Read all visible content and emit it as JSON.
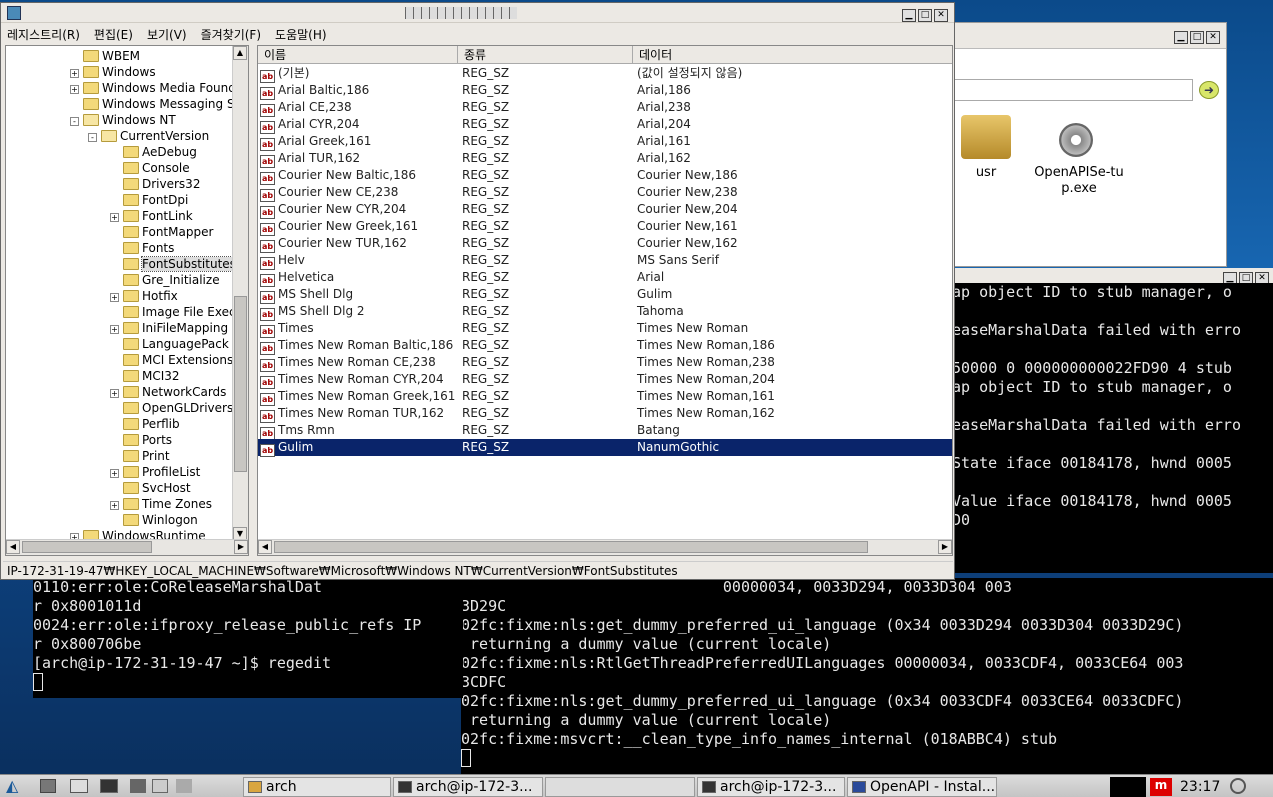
{
  "regedit": {
    "menu": [
      "레지스트리(R)",
      "편집(E)",
      "보기(V)",
      "즐겨찾기(F)",
      "도움말(H)"
    ],
    "tree": [
      {
        "label": "WBEM",
        "indent": 0,
        "exp": ""
      },
      {
        "label": "Windows",
        "indent": 0,
        "exp": "+"
      },
      {
        "label": "Windows Media Founda",
        "indent": 0,
        "exp": "+"
      },
      {
        "label": "Windows Messaging Su",
        "indent": 0,
        "exp": ""
      },
      {
        "label": "Windows NT",
        "indent": 0,
        "exp": "-"
      },
      {
        "label": "CurrentVersion",
        "indent": 1,
        "exp": "-"
      },
      {
        "label": "AeDebug",
        "indent": 2,
        "exp": ""
      },
      {
        "label": "Console",
        "indent": 2,
        "exp": ""
      },
      {
        "label": "Drivers32",
        "indent": 2,
        "exp": ""
      },
      {
        "label": "FontDpi",
        "indent": 2,
        "exp": ""
      },
      {
        "label": "FontLink",
        "indent": 2,
        "exp": "+"
      },
      {
        "label": "FontMapper",
        "indent": 2,
        "exp": ""
      },
      {
        "label": "Fonts",
        "indent": 2,
        "exp": ""
      },
      {
        "label": "FontSubstitutes",
        "indent": 2,
        "exp": "",
        "selected": true
      },
      {
        "label": "Gre_Initialize",
        "indent": 2,
        "exp": ""
      },
      {
        "label": "Hotfix",
        "indent": 2,
        "exp": "+"
      },
      {
        "label": "Image File Execu",
        "indent": 2,
        "exp": ""
      },
      {
        "label": "IniFileMapping",
        "indent": 2,
        "exp": "+"
      },
      {
        "label": "LanguagePack",
        "indent": 2,
        "exp": ""
      },
      {
        "label": "MCI Extensions",
        "indent": 2,
        "exp": ""
      },
      {
        "label": "MCI32",
        "indent": 2,
        "exp": ""
      },
      {
        "label": "NetworkCards",
        "indent": 2,
        "exp": "+"
      },
      {
        "label": "OpenGLDrivers",
        "indent": 2,
        "exp": ""
      },
      {
        "label": "Perflib",
        "indent": 2,
        "exp": ""
      },
      {
        "label": "Ports",
        "indent": 2,
        "exp": ""
      },
      {
        "label": "Print",
        "indent": 2,
        "exp": ""
      },
      {
        "label": "ProfileList",
        "indent": 2,
        "exp": "+"
      },
      {
        "label": "SvcHost",
        "indent": 2,
        "exp": ""
      },
      {
        "label": "Time Zones",
        "indent": 2,
        "exp": "+"
      },
      {
        "label": "Winlogon",
        "indent": 2,
        "exp": ""
      },
      {
        "label": "WindowsRuntime",
        "indent": 0,
        "exp": "+"
      }
    ],
    "columns": [
      "이름",
      "종류",
      "데이터"
    ],
    "rows": [
      [
        "(기본)",
        "REG_SZ",
        "(값이 설정되지 않음)"
      ],
      [
        "Arial Baltic,186",
        "REG_SZ",
        "Arial,186"
      ],
      [
        "Arial CE,238",
        "REG_SZ",
        "Arial,238"
      ],
      [
        "Arial CYR,204",
        "REG_SZ",
        "Arial,204"
      ],
      [
        "Arial Greek,161",
        "REG_SZ",
        "Arial,161"
      ],
      [
        "Arial TUR,162",
        "REG_SZ",
        "Arial,162"
      ],
      [
        "Courier New Baltic,186",
        "REG_SZ",
        "Courier New,186"
      ],
      [
        "Courier New CE,238",
        "REG_SZ",
        "Courier New,238"
      ],
      [
        "Courier New CYR,204",
        "REG_SZ",
        "Courier New,204"
      ],
      [
        "Courier New Greek,161",
        "REG_SZ",
        "Courier New,161"
      ],
      [
        "Courier New TUR,162",
        "REG_SZ",
        "Courier New,162"
      ],
      [
        "Helv",
        "REG_SZ",
        "MS Sans Serif"
      ],
      [
        "Helvetica",
        "REG_SZ",
        "Arial"
      ],
      [
        "MS Shell Dlg",
        "REG_SZ",
        "Gulim"
      ],
      [
        "MS Shell Dlg 2",
        "REG_SZ",
        "Tahoma"
      ],
      [
        "Times",
        "REG_SZ",
        "Times New Roman"
      ],
      [
        "Times New Roman Baltic,186",
        "REG_SZ",
        "Times New Roman,186"
      ],
      [
        "Times New Roman CE,238",
        "REG_SZ",
        "Times New Roman,238"
      ],
      [
        "Times New Roman CYR,204",
        "REG_SZ",
        "Times New Roman,204"
      ],
      [
        "Times New Roman Greek,161",
        "REG_SZ",
        "Times New Roman,161"
      ],
      [
        "Times New Roman TUR,162",
        "REG_SZ",
        "Times New Roman,162"
      ],
      [
        "Tms Rmn",
        "REG_SZ",
        "Batang"
      ],
      [
        "Gulim",
        "REG_SZ",
        "NanumGothic"
      ]
    ],
    "status": "IP-172-31-19-47₩HKEY_LOCAL_MACHINE₩Software₩Microsoft₩Windows NT₩CurrentVersion₩FontSubstitutes"
  },
  "explorer": {
    "items": [
      {
        "label": "usr",
        "icon": "folder-icon"
      },
      {
        "label": "OpenAPISe-tup.exe",
        "icon": "gear-icon"
      }
    ]
  },
  "term_right": [
    "ap object ID to stub manager, o",
    "",
    "easeMarshalData failed with erro",
    "",
    "50000 0 000000000022FD90 4 stub",
    "ap object ID to stub manager, o",
    "",
    "easeMarshalData failed with erro",
    "",
    "State iface 00184178, hwnd 0005",
    "",
    "Value iface 00184178, hwnd 0005"
  ],
  "term_left": [
    "0110:err:ole:CoReleaseMarshalDat",
    "r 0x8001011d",
    "0024:err:ole:ifproxy_release_public_refs IP",
    "r 0x800706be",
    "[arch@ip-172-31-19-47 ~]$ regedit"
  ],
  "term_bottom": [
    "                             00000034, 0033D294, 0033D304 003",
    "3D29C",
    "02fc:fixme:nls:get_dummy_preferred_ui_language (0x34 0033D294 0033D304 0033D29C)",
    " returning a dummy value (current locale)",
    "02fc:fixme:nls:RtlGetThreadPreferredUILanguages 00000034, 0033CDF4, 0033CE64 003",
    "3CDFC",
    "02fc:fixme:nls:get_dummy_preferred_ui_language (0x34 0033CDF4 0033CE64 0033CDFC)",
    " returning a dummy value (current locale)",
    "02fc:fixme:msvcrt:__clean_type_info_names_internal (018ABBC4) stub"
  ],
  "term_right_tail": "D0",
  "taskbar": {
    "tasks": [
      "arch",
      "arch@ip-172-3...",
      "arch@ip-172-3...",
      "OpenAPI - Instal..."
    ],
    "clock": "23:17"
  }
}
